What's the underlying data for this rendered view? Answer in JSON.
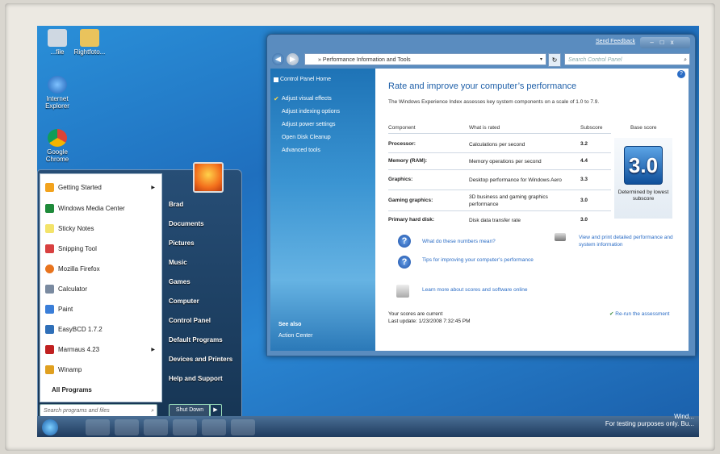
{
  "desktop": {
    "icons": [
      {
        "label": "...file"
      },
      {
        "label": "Rightfoto..."
      },
      {
        "label": "Internet Explorer"
      },
      {
        "label": "Google Chrome"
      }
    ],
    "watermark": {
      "line1": "Wind...",
      "line2": "For testing purposes only. Bu..."
    }
  },
  "start_menu": {
    "programs": [
      {
        "label": "Getting Started",
        "has_arrow": true,
        "color": "#f2a31e"
      },
      {
        "label": "Windows Media Center",
        "has_arrow": false,
        "color": "#1e8a3a"
      },
      {
        "label": "Sticky Notes",
        "has_arrow": false,
        "color": "#f3e36a"
      },
      {
        "label": "Snipping Tool",
        "has_arrow": false,
        "color": "#d84040"
      },
      {
        "label": "Mozilla Firefox",
        "has_arrow": false,
        "color": "#e8741e"
      },
      {
        "label": "Calculator",
        "has_arrow": false,
        "color": "#7a8aa0"
      },
      {
        "label": "Paint",
        "has_arrow": false,
        "color": "#3a7ed8"
      },
      {
        "label": "EasyBCD 1.7.2",
        "has_arrow": false,
        "color": "#2f6fb8"
      },
      {
        "label": "Marmaus 4.23",
        "has_arrow": true,
        "color": "#c02020"
      },
      {
        "label": "Winamp",
        "has_arrow": false,
        "color": "#e0a020"
      }
    ],
    "arrow_glyph": "▶",
    "all_programs": "All Programs",
    "search_placeholder": "Search programs and files",
    "search_icon": "⌕",
    "right_items": [
      "Brad",
      "Documents",
      "Pictures",
      "Music",
      "Games",
      "Computer",
      "Control Panel",
      "Default Programs",
      "Devices and Printers",
      "Help and Support"
    ],
    "shutdown_label": "Shut Down",
    "shutdown_arrow": "▶"
  },
  "window": {
    "send_feedback": "Send Feedback",
    "controls": "–□x",
    "back": "◀",
    "forward": "▶",
    "address": "» Performance Information and Tools",
    "address_dd": "▾",
    "refresh_icon": "↻",
    "search_placeholder": "Search Control Panel",
    "search_icon": "⌕",
    "left_pane": {
      "home": "Control Panel Home",
      "tasks": [
        "Adjust visual effects",
        "Adjust indexing options",
        "Adjust power settings",
        "Open Disk Cleanup",
        "Advanced tools"
      ],
      "see_also_title": "See also",
      "see_also": [
        "Action Center"
      ]
    },
    "main": {
      "help_glyph": "?",
      "heading": "Rate and improve your computer’s performance",
      "description": "The Windows Experience Index assesses key system components on a scale of 1.0 to 7.9.",
      "table_headers": {
        "component": "Component",
        "what": "What is rated",
        "subscore": "Subscore",
        "base": "Base score"
      },
      "rows": [
        {
          "component": "Processor:",
          "what": "Calculations per second",
          "subscore": "3.2"
        },
        {
          "component": "Memory (RAM):",
          "what": "Memory operations per second",
          "subscore": "4.4"
        },
        {
          "component": "Graphics:",
          "what": "Desktop performance for Windows Aero",
          "subscore": "3.3"
        },
        {
          "component": "Gaming graphics:",
          "what": "3D business and gaming graphics performance",
          "subscore": "3.0"
        },
        {
          "component": "Primary hard disk:",
          "what": "Disk data transfer rate",
          "subscore": "3.0"
        }
      ],
      "base_score": "3.0",
      "base_caption": "Determined by lowest subscore",
      "links": [
        {
          "text": "What do these numbers mean?",
          "icon": "help-icon"
        },
        {
          "text": "Tips for improving your computer’s performance",
          "icon": "help-icon"
        },
        {
          "text": "Learn more about scores and software online",
          "icon": "software-icon"
        }
      ],
      "print_link": "View and print detailed performance and system information",
      "status_line1": "Your scores are current",
      "status_line2": "Last update: 1/23/2008 7:32:45 PM",
      "rerun": "Re-run the assessment"
    }
  }
}
